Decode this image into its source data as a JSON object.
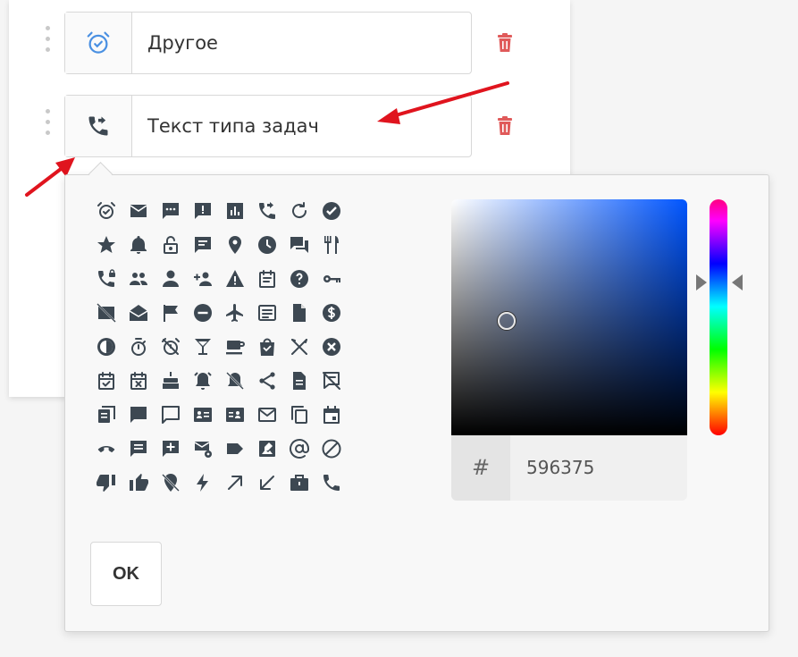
{
  "rows": [
    {
      "icon": "alarm-clock-icon",
      "icon_color": "#4a90e2",
      "value": "Другое"
    },
    {
      "icon": "phone-forward-icon",
      "icon_color": "#3d4852",
      "value": "Текст типа задач"
    }
  ],
  "colors": {
    "icon_default": "#3d4852",
    "delete": "#e05a5a",
    "annotation_arrow": "#e0141e",
    "selected_hex": "#596375"
  },
  "picker": {
    "icons": [
      [
        "alarm-clock-icon",
        "envelope-icon",
        "chat-dots-icon",
        "alert-message-icon",
        "bar-chart-icon",
        "phone-forward-icon",
        "redo-icon",
        "check-circle-icon"
      ],
      [
        "star-icon",
        "bell-icon",
        "lock-open-icon",
        "message-icon",
        "map-pin-icon",
        "clock-icon",
        "chat-bubbles-icon",
        "cutlery-icon"
      ],
      [
        "phone-lock-icon",
        "users-icon",
        "user-icon",
        "add-user-icon",
        "warning-icon",
        "calendar-note-icon",
        "help-circle-icon",
        "key-icon"
      ],
      [
        "no-card-icon",
        "open-mail-icon",
        "flag-icon",
        "minus-circle-icon",
        "airplane-icon",
        "list-card-icon",
        "file-icon",
        "dollar-icon"
      ],
      [
        "half-circle-icon",
        "stopwatch-icon",
        "alarm-off-icon",
        "cocktail-icon",
        "coffee-icon",
        "shopping-bag-icon",
        "cross-tools-icon",
        "close-circle-icon"
      ],
      [
        "calendar-check-icon",
        "calendar-x-icon",
        "cake-icon",
        "alarm-bell-icon",
        "bell-off-icon",
        "share-icon",
        "document-icon",
        "no-comment-icon"
      ],
      [
        "layers-icon",
        "comment-icon",
        "comment-outline-icon",
        "id-card-icon",
        "contact-card-icon",
        "mail-outline-icon",
        "copy-icon",
        "calendar-icon"
      ],
      [
        "hang-up-icon",
        "note-icon",
        "add-box-icon",
        "mail-settings-icon",
        "label-icon",
        "image-edit-icon",
        "at-sign-icon",
        "block-icon"
      ],
      [
        "thumb-down-icon",
        "thumb-up-icon",
        "location-off-icon",
        "lightning-icon",
        "arrow-up-right-icon",
        "arrow-down-left-icon",
        "briefcase-icon",
        "phone-icon"
      ]
    ],
    "hex_prefix": "#",
    "hex_value": "596375",
    "ok_label": "OK"
  }
}
